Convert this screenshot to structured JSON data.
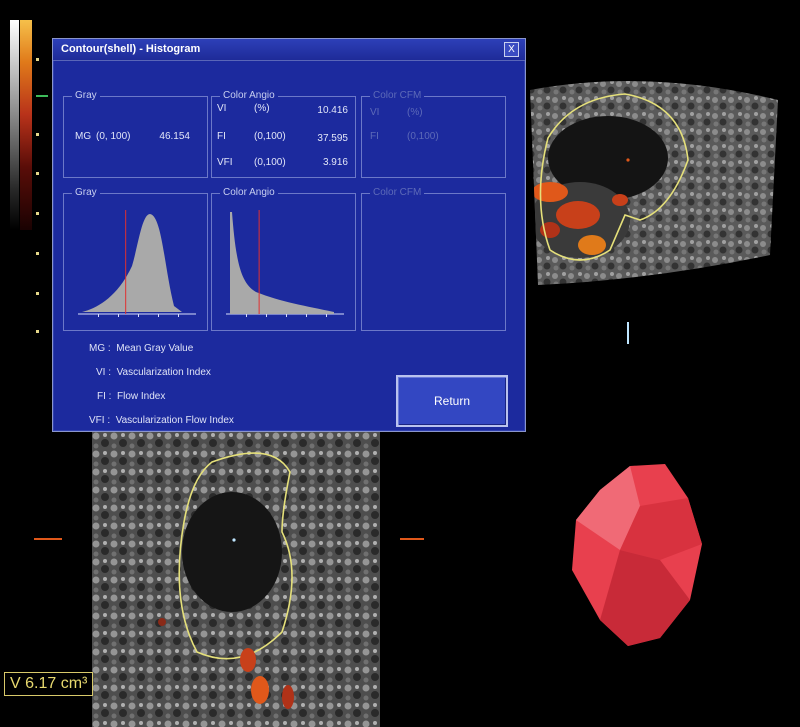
{
  "dialog": {
    "title": "Contour(shell) - Histogram",
    "close_label": "X",
    "return_label": "Return"
  },
  "stats": {
    "gray": {
      "label": "Gray",
      "rows": [
        {
          "name": "MG",
          "range": "(0, 100)",
          "value": "46.154"
        }
      ]
    },
    "color_angio": {
      "label": "Color Angio",
      "rows": [
        {
          "name": "VI",
          "range": "(%)",
          "value": "10.416"
        },
        {
          "name": "FI",
          "range": "(0,100)",
          "value": "37.595"
        },
        {
          "name": "VFI",
          "range": "(0,100)",
          "value": "3.916"
        }
      ]
    },
    "color_cfm": {
      "label": "Color CFM",
      "rows": [
        {
          "name": "VI",
          "range": "(%)"
        },
        {
          "name": "FI",
          "range": "(0,100)"
        }
      ]
    }
  },
  "histograms": {
    "gray": {
      "label": "Gray",
      "marker_fraction": 0.42,
      "fill_color": "#a9a9a9",
      "marker_color": "#e03030"
    },
    "color_angio": {
      "label": "Color Angio",
      "marker_fraction": 0.28,
      "fill_color": "#a9a9a9",
      "marker_color": "#e03030"
    },
    "color_cfm": {
      "label": "Color CFM"
    }
  },
  "legend": [
    {
      "abbr": "MG :",
      "text": "Mean Gray Value"
    },
    {
      "abbr": "VI :",
      "text": "Vascularization Index"
    },
    {
      "abbr": "FI :",
      "text": "Flow Index"
    },
    {
      "abbr": "VFI :",
      "text": "Vascularization Flow Index"
    }
  ],
  "readout": {
    "volume": "V 6.17 cm³"
  },
  "colors": {
    "dialog_bg": "#1c2a9e",
    "contour": "#e5e07a",
    "volume_model": "#e8404e",
    "doppler_orange": "#e0581a"
  },
  "icons": {
    "close": "close-icon"
  }
}
